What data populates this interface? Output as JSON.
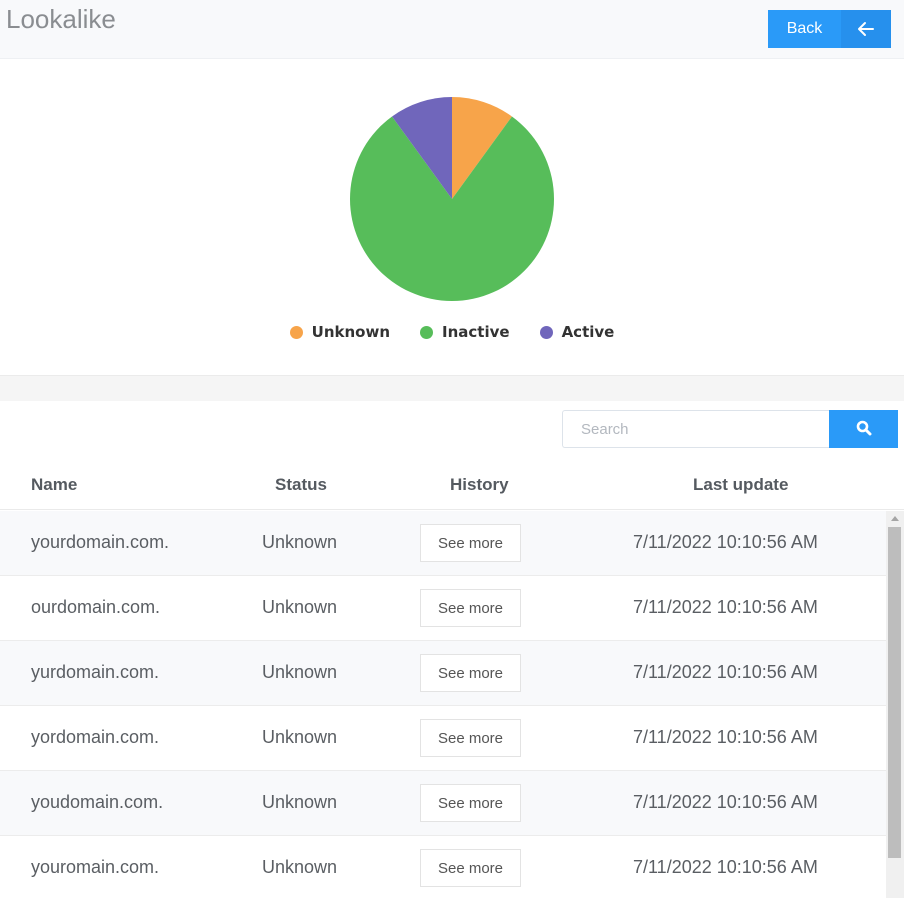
{
  "header": {
    "title": "Lookalike",
    "back_label": "Back",
    "back_icon": "arrow-left-icon"
  },
  "chart_data": {
    "type": "pie",
    "title": "",
    "categories": [
      "Unknown",
      "Inactive",
      "Active"
    ],
    "values": [
      1,
      8,
      1
    ],
    "percentages": [
      10,
      80,
      10
    ],
    "colors": [
      "#f7a44a",
      "#57bd5a",
      "#7066bb"
    ],
    "legend_position": "bottom"
  },
  "search": {
    "placeholder": "Search",
    "value": "",
    "icon": "search-icon"
  },
  "table": {
    "columns": [
      "Name",
      "Status",
      "History",
      "Last update"
    ],
    "rows": [
      {
        "name": "yourdomain.com.",
        "status": "Unknown",
        "history": "See more",
        "last_update": "7/11/2022 10:10:56 AM"
      },
      {
        "name": "ourdomain.com.",
        "status": "Unknown",
        "history": "See more",
        "last_update": "7/11/2022 10:10:56 AM"
      },
      {
        "name": "yurdomain.com.",
        "status": "Unknown",
        "history": "See more",
        "last_update": "7/11/2022 10:10:56 AM"
      },
      {
        "name": "yordomain.com.",
        "status": "Unknown",
        "history": "See more",
        "last_update": "7/11/2022 10:10:56 AM"
      },
      {
        "name": "youdomain.com.",
        "status": "Unknown",
        "history": "See more",
        "last_update": "7/11/2022 10:10:56 AM"
      },
      {
        "name": "youromain.com.",
        "status": "Unknown",
        "history": "See more",
        "last_update": "7/11/2022 10:10:56 AM"
      }
    ]
  }
}
